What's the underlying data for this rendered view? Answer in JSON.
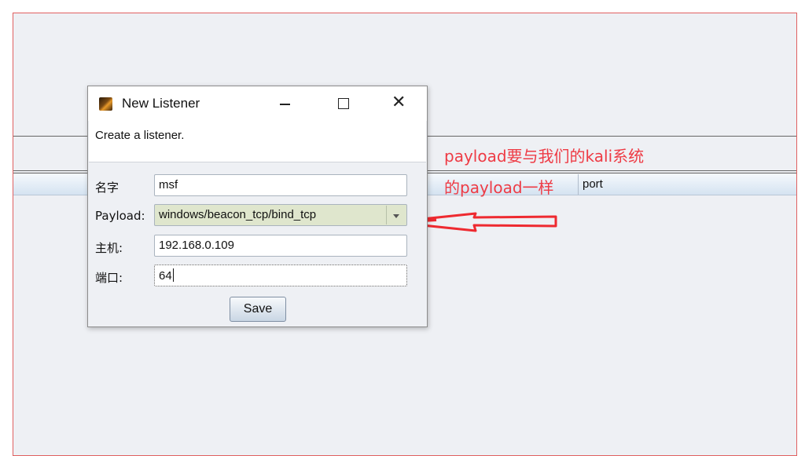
{
  "background": {
    "table": {
      "columns": [
        "port"
      ]
    },
    "annotation": {
      "line1": "payload要与我们的kali系统",
      "line2": "的payload一样",
      "color": "#ee3b45"
    }
  },
  "dialog": {
    "title": "New Listener",
    "description": "Create a listener.",
    "fields": {
      "name": {
        "label": "名字",
        "value": "msf"
      },
      "payload": {
        "label": "Payload:",
        "value": "windows/beacon_tcp/bind_tcp"
      },
      "host": {
        "label": "主机:",
        "value": "192.168.0.109"
      },
      "port": {
        "label": "端口:",
        "value": "64"
      }
    },
    "save_label": "Save",
    "window_buttons": {
      "minimize": "minimize-icon",
      "maximize": "maximize-icon",
      "close": "close-icon"
    }
  }
}
